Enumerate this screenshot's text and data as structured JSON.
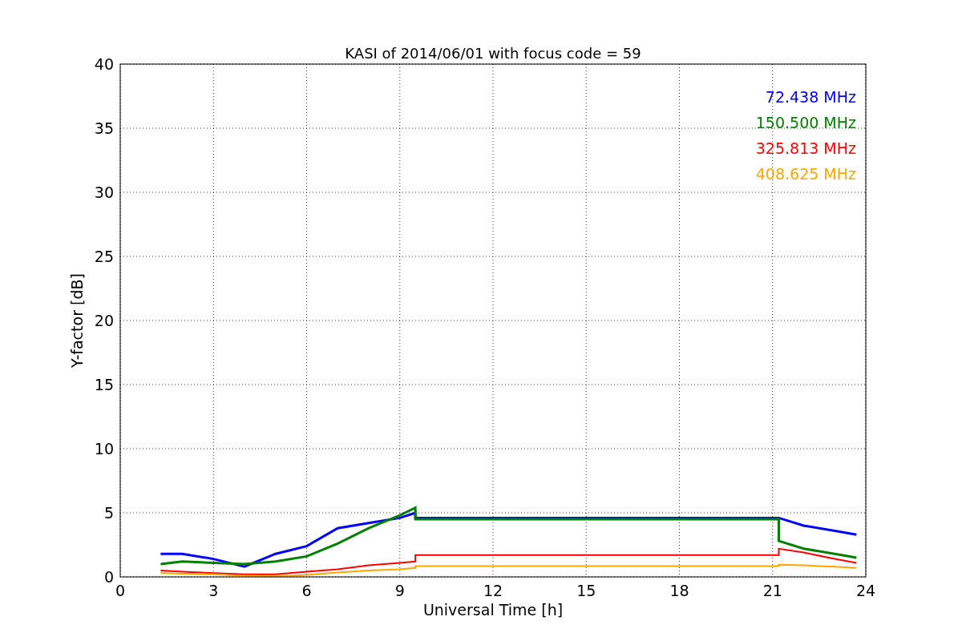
{
  "chart_data": {
    "type": "line",
    "title": "KASI of 2014/06/01 with focus code = 59",
    "xlabel": "Universal Time [h]",
    "ylabel": "Y-factor [dB]",
    "x": [
      1.3,
      2,
      3,
      4,
      5,
      6,
      7,
      8,
      9,
      9.5,
      9.5,
      21.2,
      21.2,
      22,
      23,
      23.7
    ],
    "series": [
      {
        "name": "72.438 MHz",
        "color": "#0000ff",
        "values": [
          1.8,
          1.8,
          1.4,
          0.8,
          1.8,
          2.4,
          3.8,
          4.2,
          4.6,
          5.0,
          4.6,
          4.6,
          4.6,
          4.0,
          3.6,
          3.3
        ]
      },
      {
        "name": "150.500 MHz",
        "color": "#008000",
        "values": [
          1.0,
          1.2,
          1.1,
          1.0,
          1.2,
          1.6,
          2.6,
          3.8,
          4.8,
          5.4,
          4.5,
          4.5,
          2.8,
          2.2,
          1.8,
          1.5
        ]
      },
      {
        "name": "325.813 MHz",
        "color": "#ff0000",
        "values": [
          0.5,
          0.4,
          0.3,
          0.2,
          0.2,
          0.4,
          0.6,
          0.9,
          1.1,
          1.2,
          1.7,
          1.7,
          2.2,
          1.9,
          1.4,
          1.1
        ]
      },
      {
        "name": "408.625 MHz",
        "color": "#ffa500",
        "values": [
          0.3,
          0.25,
          0.2,
          0.1,
          0.05,
          0.15,
          0.35,
          0.5,
          0.6,
          0.7,
          0.85,
          0.85,
          0.95,
          0.9,
          0.8,
          0.7
        ]
      }
    ],
    "xlim": [
      0,
      24
    ],
    "ylim": [
      0,
      40
    ],
    "xticks": [
      0,
      3,
      6,
      9,
      12,
      15,
      18,
      21,
      24
    ],
    "yticks": [
      0,
      5,
      10,
      15,
      20,
      25,
      30,
      35,
      40
    ],
    "grid": true
  }
}
